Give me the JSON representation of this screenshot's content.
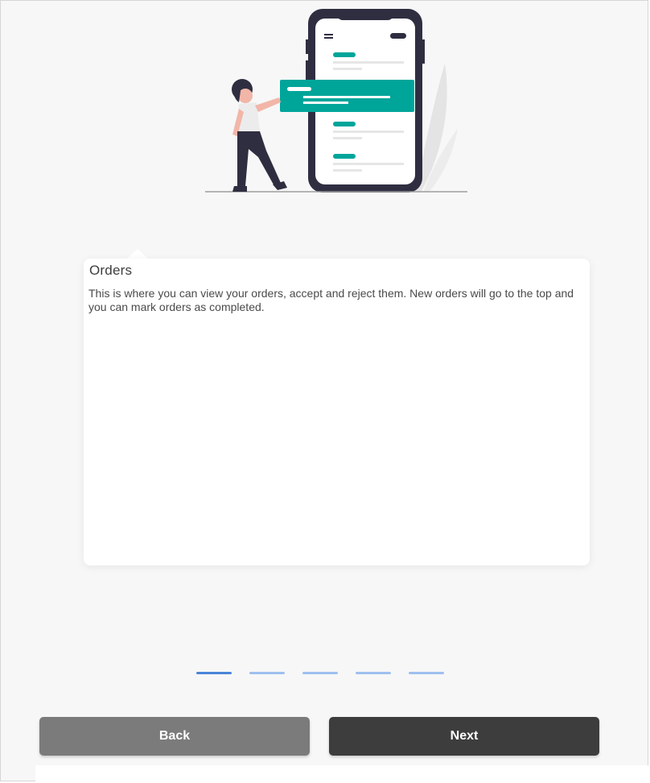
{
  "onboarding": {
    "card": {
      "title": "Orders",
      "description": "This is where you can view your orders, accept and reject them. New orders will go to the top and you can mark orders as completed."
    },
    "pager": {
      "total": 5,
      "active_index": 0
    },
    "buttons": {
      "back_label": "Back",
      "next_label": "Next"
    }
  },
  "colors": {
    "accent": "#00a59a",
    "phone_frame": "#2f2e41",
    "pager_active": "#4a84d8",
    "pager_inactive": "#9ec0ee",
    "back_button": "#7b7b7b",
    "next_button": "#3d3d3d",
    "background": "#f7f7f7"
  },
  "icons": {
    "illustration": "person-with-phone-illustration"
  }
}
